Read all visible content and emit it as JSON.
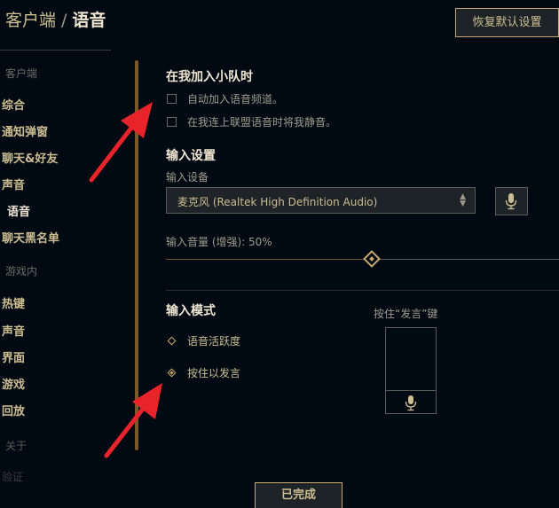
{
  "header": {
    "breadcrumb_parent": "客户端",
    "breadcrumb_sep": "/",
    "breadcrumb_current": "语音",
    "restore_defaults": "恢复默认设置"
  },
  "sidebar": {
    "section_client": "客户端",
    "client_items": [
      "综合",
      "通知弹窗",
      "聊天&好友",
      "声音",
      "语音",
      "聊天黑名单"
    ],
    "active_item": "语音",
    "section_ingame": "游戏内",
    "ingame_items": [
      "热键",
      "声音",
      "界面",
      "游戏",
      "回放"
    ],
    "about": "关于",
    "verify": "验证"
  },
  "party": {
    "title": "在我加入小队时",
    "opt_auto_join": "自动加入语音频道。",
    "opt_mute_on_join": "在我连上联盟语音时将我静音。"
  },
  "input_settings": {
    "title": "输入设置",
    "device_label": "输入设备",
    "device_value": "麦克风 (Realtek High Definition Audio)",
    "volume_label": "输入音量 (增强): 50%",
    "volume_value": 0.5
  },
  "input_mode": {
    "title": "输入模式",
    "opt_voice_activity": "语音活跃度",
    "opt_push_to_talk": "按住以发言",
    "selected": "按住以发言",
    "ptt_key_label": "按住“发言”键"
  },
  "footer": {
    "done": "已完成"
  },
  "colors": {
    "background": "#010a13",
    "gold": "#c8aa6e",
    "gold_dark": "#785a28",
    "text_light": "#f0e6d2",
    "text_gold": "#cdbe91",
    "arrow_red": "#e8232a"
  }
}
